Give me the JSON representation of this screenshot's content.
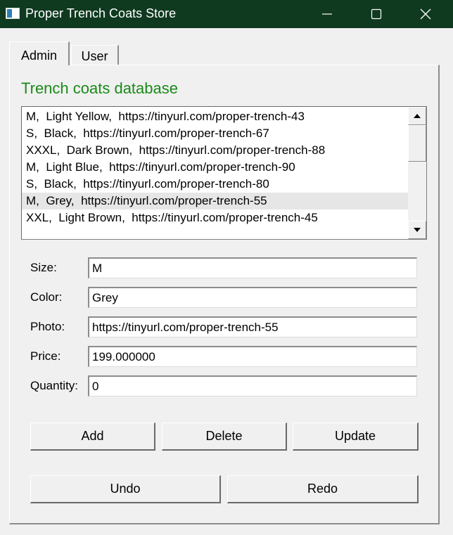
{
  "window": {
    "title": "Proper Trench Coats Store",
    "titlebar_color": "#0f3a1f"
  },
  "tabs": [
    {
      "label": "Admin",
      "active": true
    },
    {
      "label": "User",
      "active": false
    }
  ],
  "panel": {
    "title": "Trench coats database",
    "title_color": "#1a8a1a"
  },
  "listbox": {
    "items": [
      "M,  Light Yellow,  https://tinyurl.com/proper-trench-43",
      "S,  Black,  https://tinyurl.com/proper-trench-67",
      "XXXL,  Dark Brown,  https://tinyurl.com/proper-trench-88",
      "M,  Light Blue,  https://tinyurl.com/proper-trench-90",
      "S,  Black,  https://tinyurl.com/proper-trench-80",
      "M,  Grey,  https://tinyurl.com/proper-trench-55",
      "XXL,  Light Brown,  https://tinyurl.com/proper-trench-45"
    ],
    "selected_index": 5
  },
  "form": {
    "size": {
      "label": "Size:",
      "value": "M"
    },
    "color": {
      "label": "Color:",
      "value": "Grey"
    },
    "photo": {
      "label": "Photo:",
      "value": "https://tinyurl.com/proper-trench-55"
    },
    "price": {
      "label": "Price:",
      "value": "199.000000"
    },
    "quantity": {
      "label": "Quantity:",
      "value": "0"
    }
  },
  "buttons": {
    "add": "Add",
    "delete": "Delete",
    "update": "Update",
    "undo": "Undo",
    "redo": "Redo"
  },
  "icons": {
    "app": "app-window-icon",
    "minimize": "minimize-icon",
    "maximize": "maximize-icon",
    "close": "close-icon",
    "scroll_up": "arrow-up-icon",
    "scroll_down": "arrow-down-icon"
  }
}
